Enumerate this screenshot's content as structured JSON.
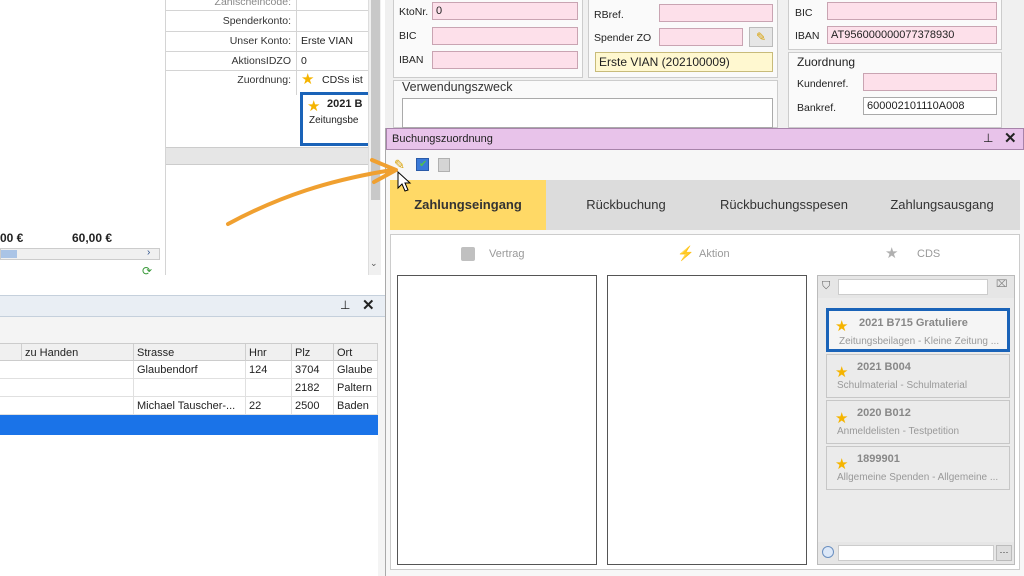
{
  "left_form": {
    "labels": {
      "zahlscheincode": "Zahlscheincode:",
      "spenderkonto": "Spenderkonto:",
      "unser_konto": "Unser Konto:",
      "aktionsidzo": "AktionsIDZO",
      "zuordnung": "Zuordnung:"
    },
    "values": {
      "unser_konto": "Erste VIAN",
      "aktionsidzo": "0",
      "zuordnung": "CDSs ist"
    },
    "card": {
      "title": "2021 B",
      "sub": "Zeitungsbe"
    },
    "totals": {
      "a": "00 €",
      "b": "60,00 €"
    }
  },
  "address_table": {
    "columns": [
      "zu Handen",
      "Strasse",
      "Hnr",
      "Plz",
      "Ort"
    ],
    "rows": [
      [
        "",
        "Glaubendorf",
        "124",
        "3704",
        "Glaube"
      ],
      [
        "",
        "",
        "",
        "2182",
        "Paltern"
      ],
      [
        "",
        "Michael Tauscher-...",
        "22",
        "2500",
        "Baden"
      ]
    ]
  },
  "bank_form": {
    "ktonr_label": "KtoNr.",
    "ktonr_value": "0",
    "bic_label": "BIC",
    "iban_label": "IBAN",
    "rbref_label": "RBref.",
    "spender_zo_label": "Spender ZO",
    "spender_zo_value": "Erste VIAN (202100009)",
    "verwendungszweck": "Verwendungszweck",
    "right_bic_label": "BIC",
    "right_iban_label": "IBAN",
    "right_iban_value": "AT956000000077378930",
    "zuordnung_title": "Zuordnung",
    "kundenref_label": "Kundenref.",
    "bankref_label": "Bankref.",
    "bankref_value": "600002101110A008"
  },
  "buchungszuordnung": {
    "title": "Buchungszuordnung",
    "tabs": [
      "Zahlungseingang",
      "Rückbuchung",
      "Rückbuchungsspesen",
      "Zahlungsausgang"
    ],
    "columns": [
      "Vertrag",
      "Aktion",
      "CDS"
    ],
    "cds_items": [
      {
        "title": "2021 B715 Gratuliere",
        "sub": "Zeitungsbeilagen - Kleine Zeitung ..."
      },
      {
        "title": "2021 B004",
        "sub": "Schulmaterial - Schulmaterial"
      },
      {
        "title": "2020 B012",
        "sub": "Anmeldelisten - Testpetition"
      },
      {
        "title": "1899901",
        "sub": "Allgemeine Spenden - Allgemeine ..."
      }
    ]
  },
  "colors": {
    "accent_tab": "#ffd966",
    "selection": "#1a63b8",
    "header_bar": "#e8c3ea",
    "arrow": "#f0a030",
    "field_pink": "#fde0ea"
  }
}
